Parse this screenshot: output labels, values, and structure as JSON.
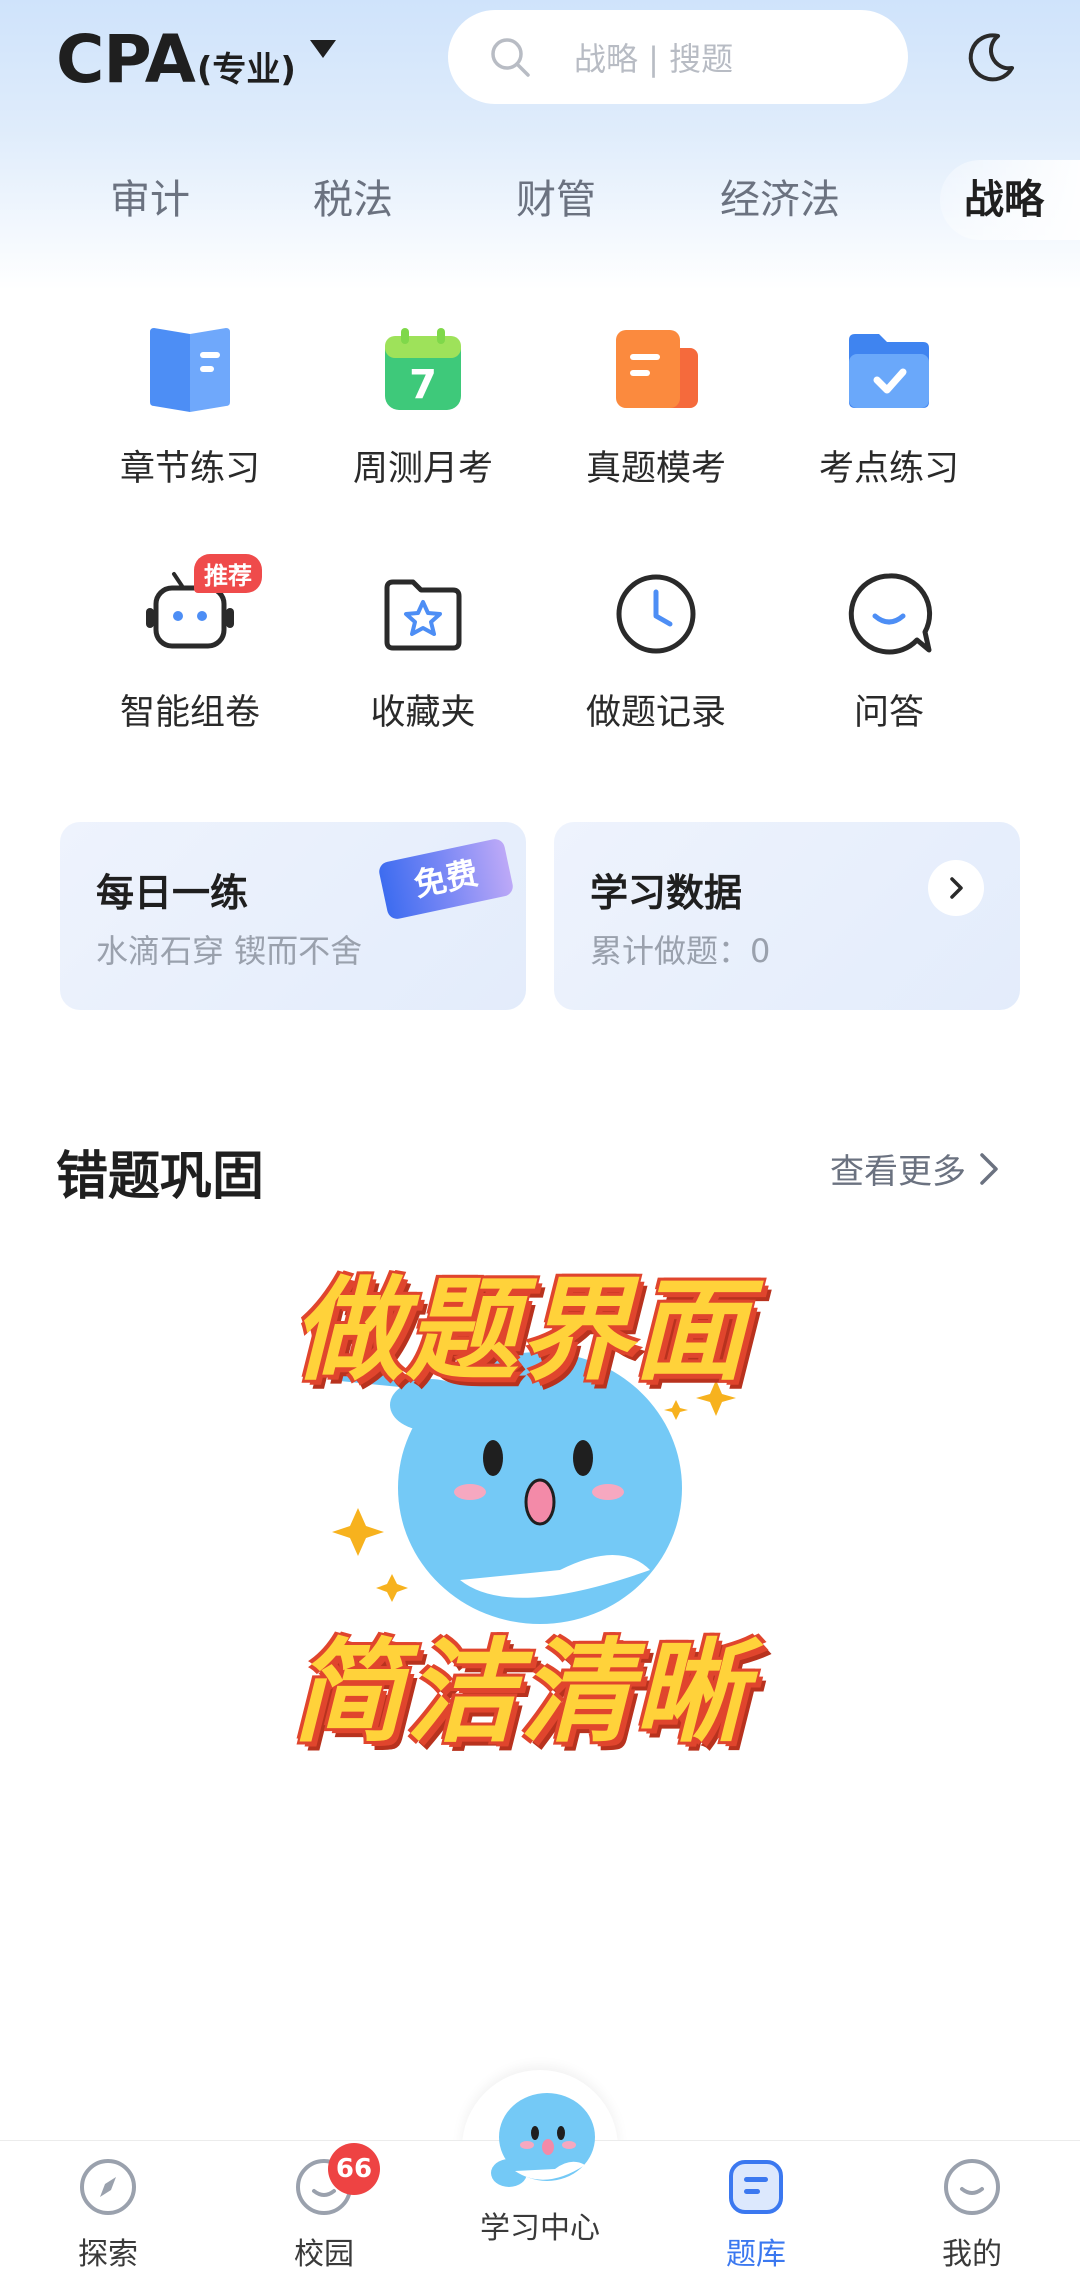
{
  "header": {
    "brand_main": "CPA",
    "brand_sub": "(专业)",
    "search_placeholder": "战略 | 搜题"
  },
  "tabs": [
    {
      "label": "审计"
    },
    {
      "label": "税法"
    },
    {
      "label": "财管"
    },
    {
      "label": "经济法"
    },
    {
      "label": "战略",
      "active": true
    }
  ],
  "features": [
    {
      "label": "章节练习",
      "icon": "book-icon"
    },
    {
      "label": "周测月考",
      "icon": "calendar-icon",
      "icon_text": "7"
    },
    {
      "label": "真题模考",
      "icon": "exam-paper-icon"
    },
    {
      "label": "考点练习",
      "icon": "folder-check-icon"
    },
    {
      "label": "智能组卷",
      "icon": "robot-icon",
      "badge": "推荐"
    },
    {
      "label": "收藏夹",
      "icon": "star-folder-icon"
    },
    {
      "label": "做题记录",
      "icon": "clock-icon"
    },
    {
      "label": "问答",
      "icon": "chat-bubble-icon"
    }
  ],
  "cards": {
    "daily": {
      "title": "每日一练",
      "subtitle": "水滴石穿 锲而不舍",
      "tag": "免费"
    },
    "stats": {
      "title": "学习数据",
      "subtitle": "累计做题：0"
    }
  },
  "section": {
    "title": "错题巩固",
    "more": "查看更多"
  },
  "promo": {
    "line1": "做题界面",
    "line2": "简洁清晰"
  },
  "bottom_nav": [
    {
      "label": "探索",
      "icon": "compass-icon"
    },
    {
      "label": "校园",
      "icon": "campus-icon",
      "badge": "66"
    },
    {
      "label": "学习中心",
      "icon": "mascot-icon"
    },
    {
      "label": "题库",
      "icon": "question-bank-icon",
      "active": true
    },
    {
      "label": "我的",
      "icon": "profile-icon"
    }
  ],
  "colors": {
    "accent": "#3b78f0",
    "badge_red": "#ee4343",
    "mascot_blue": "#6cc4f5",
    "promo_yellow": "#ffd23a",
    "promo_red": "#e0452d"
  }
}
